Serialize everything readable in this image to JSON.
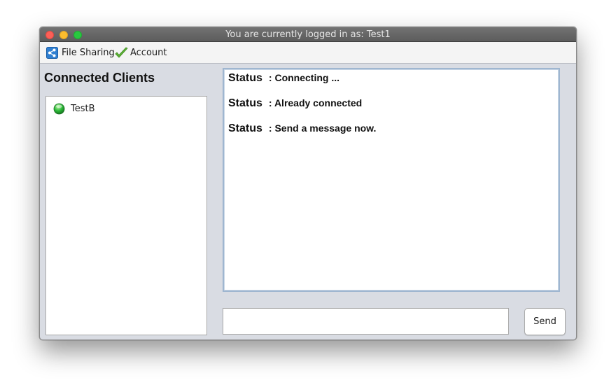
{
  "window": {
    "title": "You are currently logged in as: Test1"
  },
  "menu": {
    "items": [
      {
        "label": "File Sharing",
        "icon": "share-icon"
      },
      {
        "label": "Account",
        "icon": "checkmark-icon"
      }
    ]
  },
  "clients": {
    "heading": "Connected Clients",
    "list": [
      {
        "name": "TestB",
        "status_icon": "online-dot-icon",
        "status_color": "#2dbb3a"
      }
    ]
  },
  "messages": [
    {
      "key": "Status",
      "value": ": Connecting ..."
    },
    {
      "key": "Status",
      "value": ": Already connected"
    },
    {
      "key": "Status",
      "value": ": Send a message now."
    }
  ],
  "composer": {
    "input_value": "",
    "send_label": "Send"
  },
  "colors": {
    "accent_border": "#9fb6d0",
    "titlebar": "#646464"
  }
}
